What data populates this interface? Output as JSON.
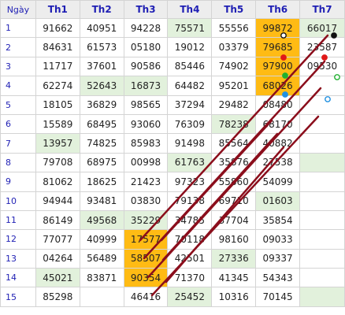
{
  "header": {
    "day": "Ngày",
    "cols": [
      "Th1",
      "Th2",
      "Th3",
      "Th4",
      "Th5",
      "Th6",
      "Th7"
    ]
  },
  "colors": {
    "highlight_orange": "#ffbb14",
    "highlight_green": "#e2f1dc",
    "line": "#8b0e1c"
  },
  "rows": [
    {
      "day": "1",
      "cells": [
        "91662",
        "40951",
        "94228",
        "75571",
        "55556",
        "99872",
        "66017"
      ],
      "hl": [
        "",
        "",
        "",
        "g",
        "",
        "o",
        "g"
      ]
    },
    {
      "day": "2",
      "cells": [
        "84631",
        "61573",
        "05180",
        "19012",
        "03379",
        "79685",
        "23587"
      ],
      "hl": [
        "",
        "",
        "",
        "",
        "",
        "o",
        ""
      ]
    },
    {
      "day": "3",
      "cells": [
        "11717",
        "37601",
        "90586",
        "85446",
        "74902",
        "97900",
        "09530"
      ],
      "hl": [
        "",
        "",
        "",
        "",
        "",
        "o",
        ""
      ]
    },
    {
      "day": "4",
      "cells": [
        "62274",
        "52643",
        "16873",
        "64482",
        "95201",
        "68026",
        ""
      ],
      "hl": [
        "",
        "g",
        "g",
        "",
        "",
        "o",
        ""
      ]
    },
    {
      "day": "5",
      "cells": [
        "18105",
        "36829",
        "98565",
        "37294",
        "29482",
        "08480",
        ""
      ],
      "hl": [
        "",
        "",
        "",
        "",
        "",
        "",
        ""
      ]
    },
    {
      "day": "6",
      "cells": [
        "15589",
        "68495",
        "93060",
        "76309",
        "78238",
        "68170",
        ""
      ],
      "hl": [
        "",
        "",
        "",
        "",
        "g",
        "",
        ""
      ]
    },
    {
      "day": "7",
      "cells": [
        "13957",
        "74825",
        "85983",
        "91498",
        "85564",
        "40882",
        ""
      ],
      "hl": [
        "g",
        "",
        "",
        "",
        "",
        "",
        ""
      ]
    },
    {
      "day": "8",
      "cells": [
        "79708",
        "68975",
        "00998",
        "61763",
        "35876",
        "27538",
        ""
      ],
      "hl": [
        "",
        "",
        "",
        "g",
        "",
        "",
        "g"
      ]
    },
    {
      "day": "9",
      "cells": [
        "81062",
        "18625",
        "21423",
        "97323",
        "55860",
        "54099",
        ""
      ],
      "hl": [
        "",
        "",
        "",
        "",
        "",
        "",
        ""
      ]
    },
    {
      "day": "10",
      "cells": [
        "94944",
        "93481",
        "03830",
        "79138",
        "69710",
        "01603",
        ""
      ],
      "hl": [
        "",
        "",
        "",
        "",
        "",
        "g",
        ""
      ]
    },
    {
      "day": "11",
      "cells": [
        "86149",
        "49568",
        "35229",
        "34785",
        "37704",
        "35854",
        ""
      ],
      "hl": [
        "",
        "g",
        "g",
        "",
        "",
        "",
        ""
      ]
    },
    {
      "day": "12",
      "cells": [
        "77077",
        "40999",
        "17577",
        "70118",
        "98160",
        "09033",
        ""
      ],
      "hl": [
        "",
        "",
        "o",
        "",
        "",
        "",
        ""
      ]
    },
    {
      "day": "13",
      "cells": [
        "04264",
        "56489",
        "58507",
        "42501",
        "27336",
        "09337",
        ""
      ],
      "hl": [
        "",
        "",
        "o",
        "",
        "g",
        "",
        ""
      ]
    },
    {
      "day": "14",
      "cells": [
        "45021",
        "83871",
        "90354",
        "71370",
        "41345",
        "54343",
        ""
      ],
      "hl": [
        "g",
        "",
        "o",
        "",
        "",
        "",
        ""
      ]
    },
    {
      "day": "15",
      "cells": [
        "85298",
        "",
        "46416",
        "25452",
        "10316",
        "70145",
        ""
      ],
      "hl": [
        "",
        "",
        "",
        "g",
        "",
        "",
        "g"
      ]
    }
  ]
}
